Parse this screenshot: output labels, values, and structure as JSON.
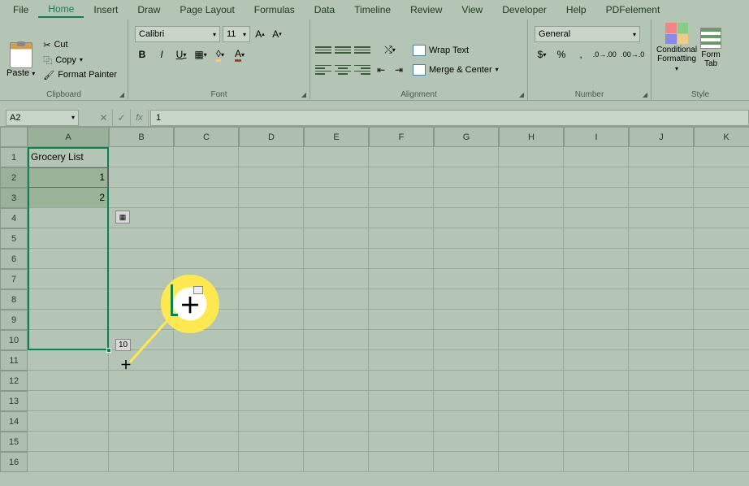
{
  "menu": [
    "File",
    "Home",
    "Insert",
    "Draw",
    "Page Layout",
    "Formulas",
    "Data",
    "Timeline",
    "Review",
    "View",
    "Developer",
    "Help",
    "PDFelement"
  ],
  "menu_active": "Home",
  "ribbon": {
    "clipboard": {
      "label": "Clipboard",
      "paste": "Paste",
      "cut": "Cut",
      "copy": "Copy",
      "format_painter": "Format Painter"
    },
    "font": {
      "label": "Font",
      "name": "Calibri",
      "size": "11",
      "bold": "B",
      "italic": "I",
      "underline": "U"
    },
    "alignment": {
      "label": "Alignment",
      "wrap": "Wrap Text",
      "merge": "Merge & Center"
    },
    "number": {
      "label": "Number",
      "format": "General",
      "currency": "$",
      "percent": "%",
      "comma": ","
    },
    "styles": {
      "label": "Style",
      "conditional": "Conditional\nFormatting",
      "table": "Form\nTab"
    }
  },
  "formula_bar": {
    "name_box": "A2",
    "fx": "fx",
    "value": "1"
  },
  "columns": [
    "A",
    "B",
    "C",
    "D",
    "E",
    "F",
    "G",
    "H",
    "I",
    "J",
    "K"
  ],
  "rows": [
    1,
    2,
    3,
    4,
    5,
    6,
    7,
    8,
    9,
    10,
    11,
    12,
    13,
    14,
    15,
    16
  ],
  "cells": {
    "A1": "Grocery List",
    "A2": "1",
    "A3": "2"
  },
  "selected_rows": [
    2,
    3
  ],
  "autofill_tooltip": "10",
  "colors": {
    "accent": "#0d8050",
    "highlight": "#ffe850"
  }
}
